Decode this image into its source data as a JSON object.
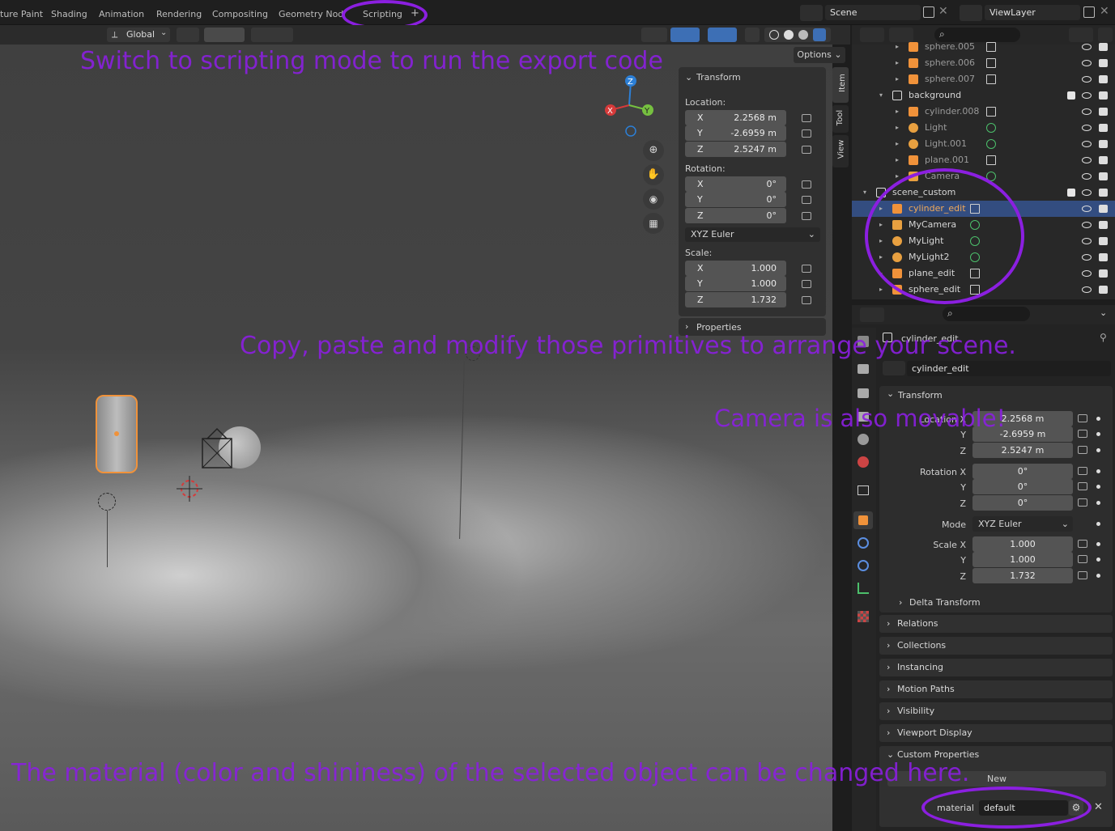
{
  "workspace_tabs": [
    "ture Paint",
    "Shading",
    "Animation",
    "Rendering",
    "Compositing",
    "Geometry Node",
    "Scripting",
    "+"
  ],
  "scene": {
    "label": "Scene",
    "view_layer": "ViewLayer"
  },
  "viewport_header": {
    "orientation": "Global",
    "options": "Options"
  },
  "npanel": {
    "tabs": [
      "Item",
      "Tool",
      "View"
    ],
    "transform_title": "Transform",
    "location_label": "Location:",
    "location": [
      {
        "axis": "X",
        "value": "2.2568 m"
      },
      {
        "axis": "Y",
        "value": "-2.6959 m"
      },
      {
        "axis": "Z",
        "value": "2.5247 m"
      }
    ],
    "rotation_label": "Rotation:",
    "rotation": [
      {
        "axis": "X",
        "value": "0°"
      },
      {
        "axis": "Y",
        "value": "0°"
      },
      {
        "axis": "Z",
        "value": "0°"
      }
    ],
    "rotation_mode": "XYZ Euler",
    "scale_label": "Scale:",
    "scale": [
      {
        "axis": "X",
        "value": "1.000"
      },
      {
        "axis": "Y",
        "value": "1.000"
      },
      {
        "axis": "Z",
        "value": "1.732"
      }
    ],
    "properties_title": "Properties"
  },
  "outliner": {
    "rows": [
      {
        "name": "sphere.005",
        "kind": "mesh",
        "indent": 2,
        "partial": true
      },
      {
        "name": "sphere.006",
        "kind": "mesh",
        "indent": 2
      },
      {
        "name": "sphere.007",
        "kind": "mesh",
        "indent": 2
      },
      {
        "name": "background",
        "kind": "collection",
        "indent": 1
      },
      {
        "name": "cylinder.008",
        "kind": "mesh",
        "indent": 2
      },
      {
        "name": "Light",
        "kind": "light",
        "indent": 2
      },
      {
        "name": "Light.001",
        "kind": "light",
        "indent": 2
      },
      {
        "name": "plane.001",
        "kind": "mesh",
        "indent": 2
      },
      {
        "name": "Camera",
        "kind": "camera",
        "indent": 2
      },
      {
        "name": "scene_custom",
        "kind": "collection",
        "indent": 0
      },
      {
        "name": "cylinder_edit",
        "kind": "mesh",
        "indent": 1,
        "selected": true
      },
      {
        "name": "MyCamera",
        "kind": "camera",
        "indent": 1
      },
      {
        "name": "MyLight",
        "kind": "light",
        "indent": 1
      },
      {
        "name": "MyLight2",
        "kind": "light",
        "indent": 1
      },
      {
        "name": "plane_edit",
        "kind": "mesh",
        "indent": 1
      },
      {
        "name": "sphere_edit",
        "kind": "mesh",
        "indent": 1
      }
    ]
  },
  "properties": {
    "object_name": "cylinder_edit",
    "object_field": "cylinder_edit",
    "transform_title": "Transform",
    "location_label": "Location X",
    "location": [
      "2.2568 m",
      "-2.6959 m",
      "2.5247 m"
    ],
    "rotation_label": "Rotation X",
    "rotation": [
      "0°",
      "0°",
      "0°"
    ],
    "mode_label": "Mode",
    "mode_value": "XYZ Euler",
    "scale_label": "Scale X",
    "scale": [
      "1.000",
      "1.000",
      "1.732"
    ],
    "axis_y": "Y",
    "axis_z": "Z",
    "delta_transform": "Delta Transform",
    "sections": [
      "Relations",
      "Collections",
      "Instancing",
      "Motion Paths",
      "Visibility",
      "Viewport Display",
      "Custom Properties"
    ],
    "new_button": "New",
    "material_label": "material",
    "material_value": "default"
  },
  "annotations": {
    "scripting": "Switch to scripting mode to run the export code",
    "copy": "Copy, paste and modify those primitives to arrange your scene.",
    "camera": "Camera is also movable!",
    "material": "The material (color and shininess) of the selected object can be changed here."
  },
  "colors": {
    "accent": "#8b1fe0",
    "selection": "#334d80",
    "object_orange": "#f0923a"
  }
}
